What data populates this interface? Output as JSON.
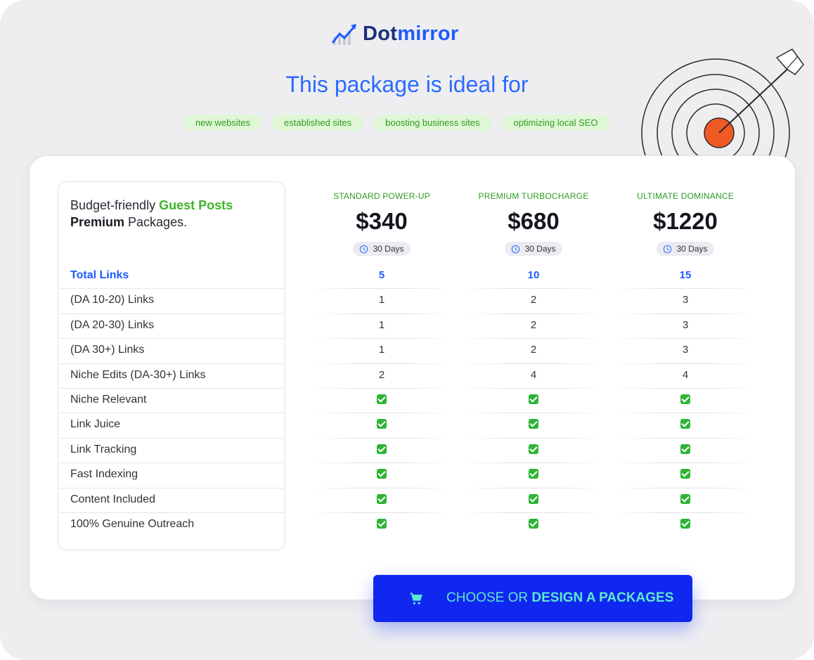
{
  "brand": {
    "logo_part1": "Dot",
    "logo_part2": "mirror"
  },
  "headline": "This package is ideal for",
  "tags": [
    "new websites",
    "established sites",
    "boosting business sites",
    "optimizing local SEO"
  ],
  "intro": {
    "pre": "Budget-friendly ",
    "highlight": "Guest Posts",
    "bold": "Premium",
    "post": " Packages."
  },
  "plans": [
    {
      "name": "STANDARD POWER-UP",
      "price": "$340",
      "duration": "30 Days"
    },
    {
      "name": "PREMIUM TURBOCHARGE",
      "price": "$680",
      "duration": "30 Days"
    },
    {
      "name": "ULTIMATE DOMINANCE",
      "price": "$1220",
      "duration": "30 Days"
    }
  ],
  "features": [
    {
      "label": "Total Links",
      "values": [
        "5",
        "10",
        "15"
      ],
      "total": true
    },
    {
      "label": "(DA 10-20) Links",
      "values": [
        "1",
        "2",
        "3"
      ]
    },
    {
      "label": "(DA 20-30) Links",
      "values": [
        "1",
        "2",
        "3"
      ]
    },
    {
      "label": "(DA 30+) Links",
      "values": [
        "1",
        "2",
        "3"
      ]
    },
    {
      "label": "Niche Edits (DA-30+) Links",
      "values": [
        "2",
        "4",
        "4"
      ]
    },
    {
      "label": "Niche Relevant",
      "values": [
        "check",
        "check",
        "check"
      ]
    },
    {
      "label": "Link Juice",
      "values": [
        "check",
        "check",
        "check"
      ]
    },
    {
      "label": "Link Tracking",
      "values": [
        "check",
        "check",
        "check"
      ]
    },
    {
      "label": "Fast Indexing",
      "values": [
        "check",
        "check",
        "check"
      ]
    },
    {
      "label": "Content Included",
      "values": [
        "check",
        "check",
        "check"
      ]
    },
    {
      "label": "100% Genuine Outreach",
      "values": [
        "check",
        "check",
        "check"
      ]
    }
  ],
  "cta": {
    "part1": "CHOOSE OR ",
    "part2": "DESIGN A PACKAGES"
  },
  "colors": {
    "accent_blue": "#1e5bff",
    "green": "#3cb526",
    "cta_bg": "#1027f0",
    "cta_text": "#5ee8cf"
  },
  "icons": {
    "logo": "chart-arrow-icon",
    "duration": "clock-icon",
    "feature_included": "checkmark-icon",
    "cta": "cart-icon",
    "decor": "dartboard-icon"
  }
}
